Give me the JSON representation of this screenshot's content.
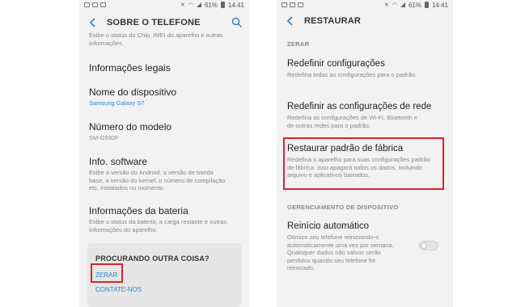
{
  "status": {
    "battery": "61%",
    "time": "14:41"
  },
  "left": {
    "title": "SOBRE O TELEFONE",
    "top_partial_sub": "Exibe o status do Chip, IMEI do aparelho e outras informações.",
    "items": [
      {
        "title": "Informações legais"
      },
      {
        "title": "Nome do dispositivo",
        "link": "Samsung Galaxy S7"
      },
      {
        "title": "Número do modelo",
        "sub": "SM-G930F"
      },
      {
        "title": "Info. software",
        "sub": "Exibe a versão do Android, a versão de banda base, a versão do kernel, o número de compilação etc. instalados no momento."
      },
      {
        "title": "Informações da bateria",
        "sub": "Exibe o status da bateria, a carga restante e outras informações do aparelho."
      }
    ],
    "card": {
      "title": "PROCURANDO OUTRA COISA?",
      "link1": "ZERAR",
      "link2": "CONTATE-NOS"
    }
  },
  "right": {
    "title": "RESTAURAR",
    "section1": "ZERAR",
    "items": [
      {
        "title": "Redefinir configurações",
        "sub": "Redefina todas as configurações para o padrão."
      },
      {
        "title": "Redefinir as configurações de rede",
        "sub": "Redefina as configurações de Wi-Fi, Bluetooth e de outras redes para o padrão."
      },
      {
        "title": "Restaurar padrão de fábrica",
        "sub": "Redefina o aparelho para suas configurações padrão de fábrica. Isso apagará todos os dados, incluindo arquivo e aplicativos baixados."
      }
    ],
    "section2": "GERENCIAMENTO DE DISPOSITIVO",
    "auto_restart": {
      "title": "Reinício automático",
      "sub": "Otimize seu telefone reiniciando-o automaticamente uma vez por semana. Quaisquer dados não salvos serão perdidos quando seu telefone for reiniciado.",
      "toggle_on": false
    }
  },
  "colors": {
    "highlight": "#d9232d",
    "link": "#2a8ac9"
  }
}
